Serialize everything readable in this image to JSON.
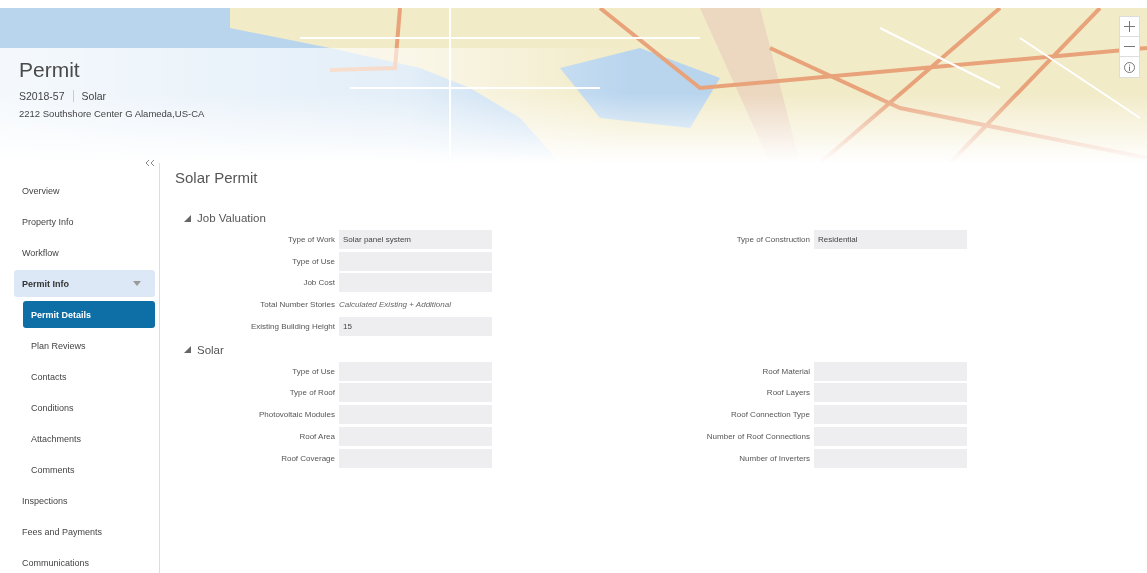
{
  "header": {
    "title": "Permit",
    "record_id": "S2018-57",
    "record_type": "Solar",
    "address": "2212 Southshore Center G Alameda,US-CA"
  },
  "sidebar": {
    "items": [
      {
        "label": "Overview",
        "selected": false
      },
      {
        "label": "Property Info",
        "selected": false
      },
      {
        "label": "Workflow",
        "selected": false
      },
      {
        "label": "Permit Info",
        "selected": false,
        "expanded": true,
        "children": [
          {
            "label": "Permit Details",
            "selected": true
          },
          {
            "label": "Plan Reviews",
            "selected": false
          },
          {
            "label": "Contacts",
            "selected": false
          },
          {
            "label": "Conditions",
            "selected": false
          },
          {
            "label": "Attachments",
            "selected": false
          },
          {
            "label": "Comments",
            "selected": false
          }
        ]
      },
      {
        "label": "Inspections",
        "selected": false
      },
      {
        "label": "Fees and Payments",
        "selected": false
      },
      {
        "label": "Communications",
        "selected": false
      }
    ]
  },
  "main": {
    "title": "Solar Permit",
    "sections": [
      {
        "title": "Job Valuation",
        "expanded": true,
        "columns": [
          [
            {
              "label": "Type of Work",
              "kind": "field",
              "value": "Solar panel system"
            },
            {
              "label": "Type of Use",
              "kind": "field"
            },
            {
              "label": "Job Cost",
              "kind": "field"
            },
            {
              "label": "Total Number Stories",
              "kind": "text",
              "value": "Calculated Existing + Additional"
            },
            {
              "label": "Existing Building Height",
              "kind": "field",
              "value": "15"
            }
          ],
          [
            {
              "label": "Type of Construction",
              "kind": "field",
              "value": "Residential"
            }
          ]
        ]
      },
      {
        "title": "Solar",
        "expanded": true,
        "columns": [
          [
            {
              "label": "Type of Use",
              "kind": "field"
            },
            {
              "label": "Type of Roof",
              "kind": "field"
            },
            {
              "label": "Photovoltaic Modules",
              "kind": "field"
            },
            {
              "label": "Roof Area",
              "kind": "field"
            },
            {
              "label": "Roof Coverage",
              "kind": "field"
            }
          ],
          [
            {
              "label": "Roof Material",
              "kind": "field"
            },
            {
              "label": "Roof Layers",
              "kind": "field"
            },
            {
              "label": "Roof Connection Type",
              "kind": "field"
            },
            {
              "label": "Number of Roof Connections",
              "kind": "field"
            },
            {
              "label": "Number of Inverters",
              "kind": "field"
            }
          ]
        ]
      }
    ]
  }
}
